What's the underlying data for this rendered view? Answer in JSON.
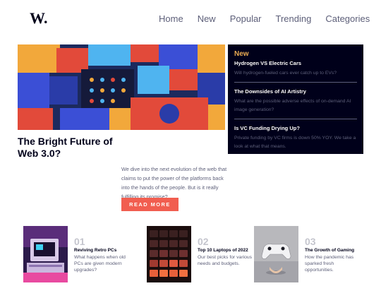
{
  "header": {
    "logo": "W.",
    "nav": [
      "Home",
      "New",
      "Popular",
      "Trending",
      "Categories"
    ]
  },
  "hero": {
    "title": "The Bright Future of Web 3.0?",
    "description": "We dive into the next evolution of the web that claims to put the power of the platforms back into the hands of the people. But is it really fulfilling its promise?",
    "button": "READ MORE"
  },
  "new_panel": {
    "heading": "New",
    "items": [
      {
        "title": "Hydrogen VS Electric Cars",
        "description": "Will hydrogen-fueled cars ever catch up to EVs?"
      },
      {
        "title": "The Downsides of AI Artistry",
        "description": "What are the possible adverse effects of on-demand AI image generation?"
      },
      {
        "title": "Is VC Funding Drying Up?",
        "description": "Private funding by VC firms is down 50% YOY. We take a look at what that means."
      }
    ]
  },
  "cards": [
    {
      "number": "01",
      "title": "Reviving Retro PCs",
      "description": "What happens when old PCs are given modern upgrades?"
    },
    {
      "number": "02",
      "title": "Top 10 Laptops of 2022",
      "description": "Our best picks for various needs and budgets."
    },
    {
      "number": "03",
      "title": "The Growth of Gaming",
      "description": "How the pandemic has sparked fresh opportunities."
    }
  ],
  "colors": {
    "accent_orange": "#e9ab53",
    "button_red": "#f15e50",
    "dark_navy": "#00001a",
    "grayish_blue": "#5d5f79"
  }
}
